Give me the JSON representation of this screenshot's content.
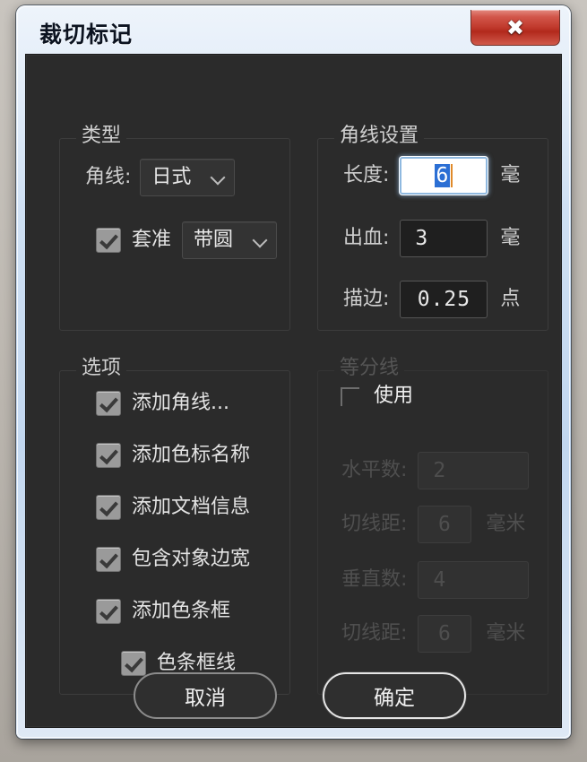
{
  "window": {
    "title": "裁切标记",
    "close_label": "✕",
    "accent_close": "#c0392c",
    "frame_color": "#cfe0f3",
    "content_bg": "#2b2b2b"
  },
  "type_group": {
    "title": "类型",
    "corner_line": {
      "label": "角线:",
      "value": "日式",
      "chevron": "chevron-down-icon"
    },
    "registration": {
      "checkbox_label": "套准",
      "checked": true,
      "value": "带圆",
      "chevron": "chevron-down-icon"
    }
  },
  "corner_settings": {
    "title": "角线设置",
    "rows": [
      {
        "label": "长度:",
        "value": "6",
        "unit": "毫",
        "focused": true
      },
      {
        "label": "出血:",
        "value": "3",
        "unit": "毫",
        "focused": false
      },
      {
        "label": "描边:",
        "value": "0.25",
        "unit": "点",
        "focused": false
      }
    ]
  },
  "options_group": {
    "title": "选项",
    "items": [
      {
        "label": "添加角线...",
        "checked": true,
        "indent": false
      },
      {
        "label": "添加色标名称",
        "checked": true,
        "indent": false
      },
      {
        "label": "添加文档信息",
        "checked": true,
        "indent": false
      },
      {
        "label": "包含对象边宽",
        "checked": true,
        "indent": false
      },
      {
        "label": "添加色条框",
        "checked": true,
        "indent": false
      },
      {
        "label": "色条框线",
        "checked": true,
        "indent": true
      }
    ]
  },
  "divide_group": {
    "title": "等分线",
    "enabled": false,
    "use": {
      "label": "使用",
      "checked": false
    },
    "rows": [
      {
        "label": "水平数:",
        "value": "2",
        "unit": ""
      },
      {
        "label": "切线距:",
        "value": "6",
        "unit": "毫米"
      },
      {
        "label": "垂直数:",
        "value": "4",
        "unit": ""
      },
      {
        "label": "切线距:",
        "value": "6",
        "unit": "毫米"
      }
    ]
  },
  "buttons": {
    "cancel": "取消",
    "ok": "确定"
  }
}
